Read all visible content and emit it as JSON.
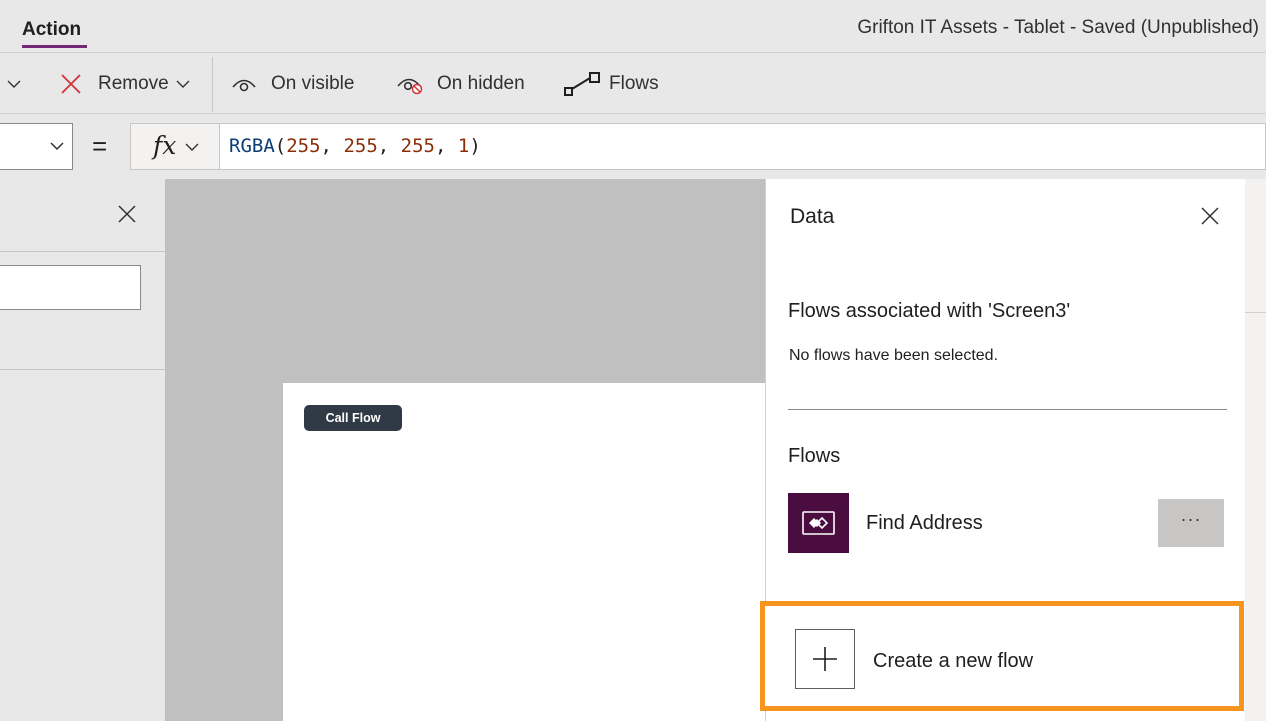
{
  "header": {
    "active_tab": "Action",
    "app_title": "Grifton IT Assets - Tablet - Saved (Unpublished)"
  },
  "ribbon": {
    "remove_label": "Remove",
    "on_visible_label": "On visible",
    "on_hidden_label": "On hidden",
    "flows_label": "Flows"
  },
  "formula_bar": {
    "equals": "=",
    "fx_label": "fx",
    "formula_fn": "RGBA",
    "formula_open": "(",
    "formula_args": [
      "255",
      "255",
      "255",
      "1"
    ],
    "formula_sep": ", ",
    "formula_close": ")"
  },
  "canvas": {
    "button_label": "Call Flow"
  },
  "data_panel": {
    "title": "Data",
    "associated_heading": "Flows associated with 'Screen3'",
    "associated_empty": "No flows have been selected.",
    "flows_heading": "Flows",
    "flows": [
      {
        "name": "Find Address",
        "more_label": "···"
      }
    ],
    "create_label": "Create a new flow"
  },
  "colors": {
    "accent": "#742774",
    "highlight": "#f7941d",
    "flow_icon_bg": "#4b0c3f"
  },
  "icons": {
    "remove": "close-x-icon",
    "on_visible": "eye-icon",
    "on_hidden": "eye-slash-icon",
    "flows": "flow-icon",
    "create": "plus-icon"
  }
}
